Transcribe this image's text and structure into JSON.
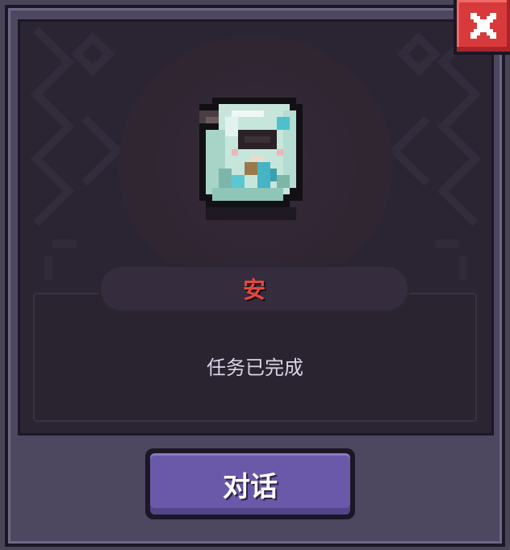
{
  "npc": {
    "name": "安",
    "status": "任务已完成",
    "name_color": "#e8473e"
  },
  "actions": {
    "talk_label": "对话",
    "close_icon": "close-icon"
  },
  "colors": {
    "frame": "#4d4760",
    "panel": "#2b2533",
    "button": "#6a58a8",
    "close_button": "#d8393b"
  }
}
